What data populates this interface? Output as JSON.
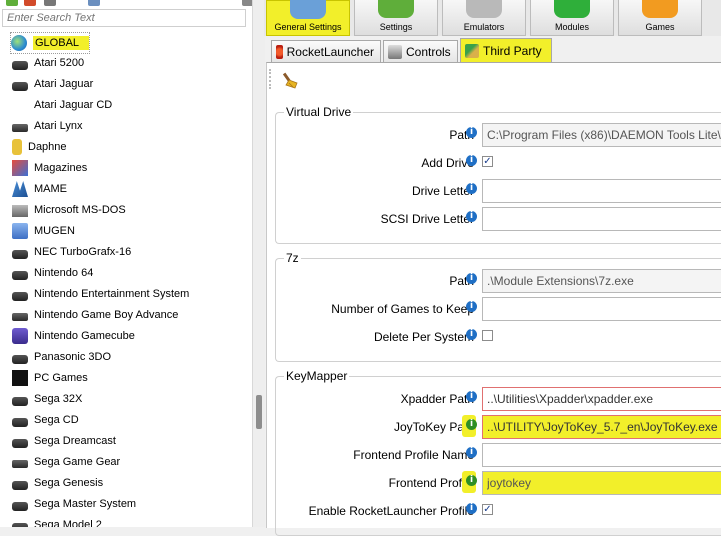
{
  "search": {
    "placeholder": "Enter Search Text"
  },
  "systems": [
    {
      "label": "GLOBAL",
      "icon": "globe-icon",
      "selected": true
    },
    {
      "label": "Atari 5200",
      "icon": "console-icon"
    },
    {
      "label": "Atari Jaguar",
      "icon": "console-icon"
    },
    {
      "label": "Atari Jaguar CD",
      "icon": ""
    },
    {
      "label": "Atari Lynx",
      "icon": "handheld-icon"
    },
    {
      "label": "Daphne",
      "icon": "daphne-icon"
    },
    {
      "label": "Magazines",
      "icon": "magazine-icon"
    },
    {
      "label": "MAME",
      "icon": "mame-icon"
    },
    {
      "label": "Microsoft MS-DOS",
      "icon": "pc-icon"
    },
    {
      "label": "MUGEN",
      "icon": "mugen-icon"
    },
    {
      "label": "NEC TurboGrafx-16",
      "icon": "console-icon"
    },
    {
      "label": "Nintendo 64",
      "icon": "console-icon"
    },
    {
      "label": "Nintendo Entertainment System",
      "icon": "console-icon"
    },
    {
      "label": "Nintendo Game Boy Advance",
      "icon": "handheld-icon"
    },
    {
      "label": "Nintendo Gamecube",
      "icon": "gamecube-icon"
    },
    {
      "label": "Panasonic 3DO",
      "icon": "console-icon"
    },
    {
      "label": "PC Games",
      "icon": "pc-games-icon"
    },
    {
      "label": "Sega 32X",
      "icon": "console-icon"
    },
    {
      "label": "Sega CD",
      "icon": "console-icon"
    },
    {
      "label": "Sega Dreamcast",
      "icon": "console-icon"
    },
    {
      "label": "Sega Game Gear",
      "icon": "handheld-icon"
    },
    {
      "label": "Sega Genesis",
      "icon": "console-icon"
    },
    {
      "label": "Sega Master System",
      "icon": "console-icon"
    },
    {
      "label": "Sega Model 2",
      "icon": "console-icon"
    }
  ],
  "main_tabs": [
    {
      "label": "General Settings",
      "icon": "general-settings-icon",
      "active": true
    },
    {
      "label": "Settings",
      "icon": "settings-icon"
    },
    {
      "label": "Emulators",
      "icon": "emulators-icon"
    },
    {
      "label": "Modules",
      "icon": "modules-icon"
    },
    {
      "label": "Games",
      "icon": "games-icon"
    }
  ],
  "sub_tabs": [
    {
      "label": "RocketLauncher",
      "icon": "rocket-icon"
    },
    {
      "label": "Controls",
      "icon": "controls-icon"
    },
    {
      "label": "Third Party",
      "icon": "tools-icon",
      "active": true
    }
  ],
  "toolbar": {
    "icon": "broom-icon"
  },
  "groups": [
    {
      "title": "Virtual Drive",
      "rows": [
        {
          "label": "Path",
          "type": "text",
          "value": "C:\\Program Files (x86)\\DAEMON Tools Lite\\D",
          "readonly": true
        },
        {
          "label": "Add Drive",
          "type": "checkbox",
          "checked": true
        },
        {
          "label": "Drive Letter",
          "type": "text",
          "value": ""
        },
        {
          "label": "SCSI Drive Letter",
          "type": "text",
          "value": ""
        }
      ]
    },
    {
      "title": "7z",
      "rows": [
        {
          "label": "Path",
          "type": "text",
          "value": ".\\Module Extensions\\7z.exe",
          "readonly": true
        },
        {
          "label": "Number of Games to Keep",
          "type": "text",
          "value": ""
        },
        {
          "label": "Delete Per System",
          "type": "checkbox",
          "checked": false
        }
      ]
    },
    {
      "title": "KeyMapper",
      "rows": [
        {
          "label": "Xpadder Path",
          "type": "text",
          "value": "..\\Utilities\\Xpadder\\xpadder.exe",
          "error": true
        },
        {
          "label": "JoyToKey Path",
          "type": "text",
          "value": "..\\UTILITY\\JoyToKey_5.7_en\\JoyToKey.exe",
          "highlight": true,
          "error": true
        },
        {
          "label": "Frontend Profile Name",
          "type": "text",
          "value": ""
        },
        {
          "label": "Frontend Profile",
          "type": "text",
          "value": "joytokey",
          "highlight": true,
          "readonly": true
        },
        {
          "label": "Enable RocketLauncher Profile",
          "type": "checkbox",
          "checked": true
        }
      ]
    }
  ],
  "colors": {
    "highlight": "#f2ef2a",
    "info_blue": "#1f6fc5",
    "info_green": "#2f8f25"
  }
}
